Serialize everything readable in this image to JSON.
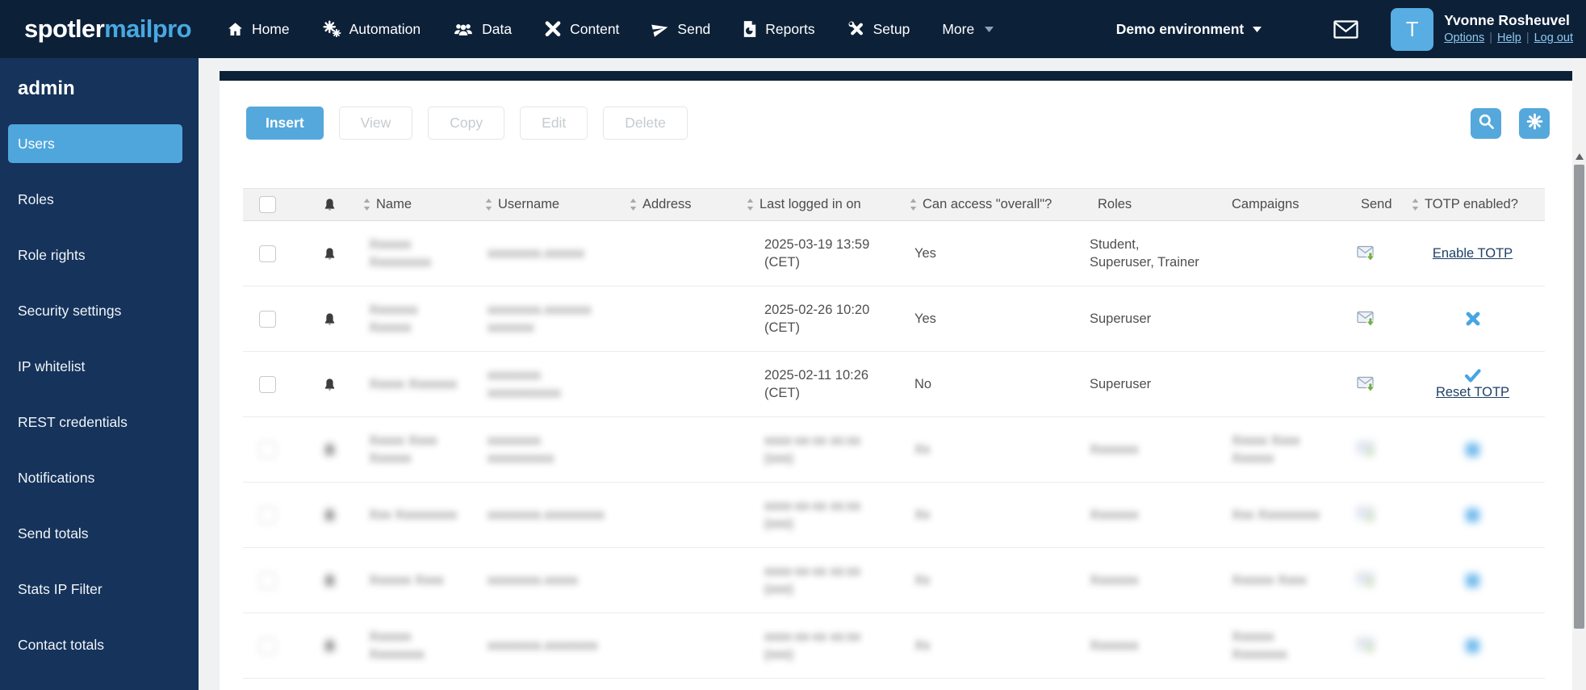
{
  "theme": {
    "topbar_color": "#0c2038",
    "sidebar_color": "#15335b",
    "accent_color": "#55a8db",
    "active_item_color": "#4fa6dc",
    "link_color": "#8ec9ee",
    "totp_icon_color": "#47a5e2"
  },
  "brand": {
    "logo_primary": "spotler",
    "logo_secondary": "mailpro"
  },
  "topnav": {
    "items": [
      {
        "label": "Home",
        "icon": "home-icon"
      },
      {
        "label": "Automation",
        "icon": "gears-icon"
      },
      {
        "label": "Data",
        "icon": "people-icon"
      },
      {
        "label": "Content",
        "icon": "pencil-icon"
      },
      {
        "label": "Send",
        "icon": "paper-plane-icon"
      },
      {
        "label": "Reports",
        "icon": "report-icon"
      },
      {
        "label": "Setup",
        "icon": "tools-icon"
      },
      {
        "label": "More",
        "icon": "caret-down-icon",
        "caret": true
      }
    ]
  },
  "environment": {
    "label": "Demo environment",
    "icon": "caret-down-icon"
  },
  "user": {
    "envelope_icon": "envelope-icon",
    "avatar_initial": "T",
    "name": "Yvonne Rosheuvel",
    "links": [
      "Options",
      "Help",
      "Log out"
    ]
  },
  "sidebar": {
    "heading": "admin",
    "items": [
      {
        "label": "Users",
        "active": true
      },
      {
        "label": "Roles",
        "active": false
      },
      {
        "label": "Role rights",
        "active": false
      },
      {
        "label": "Security settings",
        "active": false
      },
      {
        "label": "IP whitelist",
        "active": false
      },
      {
        "label": "REST credentials",
        "active": false
      },
      {
        "label": "Notifications",
        "active": false
      },
      {
        "label": "Send totals",
        "active": false
      },
      {
        "label": "Stats IP Filter",
        "active": false
      },
      {
        "label": "Contact totals",
        "active": false
      }
    ]
  },
  "toolbar": {
    "buttons": [
      {
        "label": "Insert",
        "primary": true,
        "enabled": true
      },
      {
        "label": "View",
        "primary": false,
        "enabled": false
      },
      {
        "label": "Copy",
        "primary": false,
        "enabled": false
      },
      {
        "label": "Edit",
        "primary": false,
        "enabled": false
      },
      {
        "label": "Delete",
        "primary": false,
        "enabled": false
      }
    ],
    "icon_buttons": [
      {
        "icon": "search-icon"
      },
      {
        "icon": "gear-icon"
      }
    ]
  },
  "table": {
    "columns": [
      {
        "key": "select",
        "label": "",
        "sortable": false
      },
      {
        "key": "notify",
        "label": "",
        "icon": "bell-icon",
        "sortable": false
      },
      {
        "key": "name",
        "label": "Name",
        "sortable": true
      },
      {
        "key": "username",
        "label": "Username",
        "sortable": true
      },
      {
        "key": "address",
        "label": "Address",
        "sortable": true
      },
      {
        "key": "last_login",
        "label": "Last logged in on",
        "sortable": true
      },
      {
        "key": "overall",
        "label": "Can access \"overall\"?",
        "sortable": true
      },
      {
        "key": "roles",
        "label": "Roles",
        "sortable": false
      },
      {
        "key": "campaigns",
        "label": "Campaigns",
        "sortable": false
      },
      {
        "key": "send",
        "label": "Send",
        "sortable": false
      },
      {
        "key": "totp",
        "label": "TOTP enabled?",
        "sortable": true
      }
    ],
    "rows": [
      {
        "blur_all": false,
        "name": {
          "lines": [
            "Xxxxxx",
            "Xxxxxxxxx"
          ],
          "blur": true
        },
        "username": {
          "lines": [
            "xxxxxxxx.xxxxxx"
          ],
          "blur": true
        },
        "address": {
          "lines": []
        },
        "last_login": {
          "lines": [
            "2025-03-19 13:59",
            "(CET)"
          ]
        },
        "overall": {
          "lines": [
            "Yes"
          ]
        },
        "roles": {
          "lines": [
            "Student,",
            "Superuser, Trainer"
          ]
        },
        "campaigns": {
          "lines": []
        },
        "send": {
          "icon": "send-mail-icon"
        },
        "totp": {
          "type": "link",
          "label": "Enable TOTP"
        }
      },
      {
        "blur_all": false,
        "name": {
          "lines": [
            "Xxxxxxx",
            "Xxxxxx"
          ],
          "blur": true
        },
        "username": {
          "lines": [
            "xxxxxxxx.xxxxxxx",
            "xxxxxxx"
          ],
          "blur": true
        },
        "address": {
          "lines": []
        },
        "last_login": {
          "lines": [
            "2025-02-26 10:20",
            "(CET)"
          ]
        },
        "overall": {
          "lines": [
            "Yes"
          ]
        },
        "roles": {
          "lines": [
            "Superuser"
          ]
        },
        "campaigns": {
          "lines": []
        },
        "send": {
          "icon": "send-mail-icon"
        },
        "totp": {
          "type": "cross"
        }
      },
      {
        "blur_all": false,
        "name": {
          "lines": [
            "Xxxxx Xxxxxxx"
          ],
          "blur": true
        },
        "username": {
          "lines": [
            "xxxxxxxx",
            "xxxxxxxxxxx"
          ],
          "blur": true
        },
        "address": {
          "lines": []
        },
        "last_login": {
          "lines": [
            "2025-02-11 10:26",
            "(CET)"
          ]
        },
        "overall": {
          "lines": [
            "No"
          ]
        },
        "roles": {
          "lines": [
            "Superuser"
          ]
        },
        "campaigns": {
          "lines": []
        },
        "send": {
          "icon": "send-mail-icon"
        },
        "totp": {
          "type": "check-link",
          "label": "Reset TOTP"
        }
      },
      {
        "blur_all": true,
        "name": {
          "lines": [
            "Xxxxx Xxxx",
            "Xxxxxx"
          ],
          "blur": true
        },
        "username": {
          "lines": [
            "xxxxxxxx",
            "xxxxxxxxxx"
          ],
          "blur": true
        },
        "address": {
          "lines": []
        },
        "last_login": {
          "lines": [
            "xxxx-xx-xx xx:xx",
            "(xxx)"
          ],
          "blur": true
        },
        "overall": {
          "lines": [
            "Xx"
          ],
          "blur": true
        },
        "roles": {
          "lines": [
            "Xxxxxxx"
          ],
          "blur": true
        },
        "campaigns": {
          "lines": [
            "Xxxxx Xxxx",
            "Xxxxxx"
          ],
          "blur": true
        },
        "send": {
          "icon": "send-mail-icon"
        },
        "totp": {
          "type": "square"
        }
      },
      {
        "blur_all": true,
        "name": {
          "lines": [
            "Xxx Xxxxxxxxx"
          ],
          "blur": true
        },
        "username": {
          "lines": [
            "xxxxxxxx.xxxxxxxxx"
          ],
          "blur": true
        },
        "address": {
          "lines": []
        },
        "last_login": {
          "lines": [
            "xxxx-xx-xx xx:xx",
            "(xxx)"
          ],
          "blur": true
        },
        "overall": {
          "lines": [
            "Xx"
          ],
          "blur": true
        },
        "roles": {
          "lines": [
            "Xxxxxxx"
          ],
          "blur": true
        },
        "campaigns": {
          "lines": [
            "Xxx Xxxxxxxxx"
          ],
          "blur": true
        },
        "send": {
          "icon": "send-mail-icon"
        },
        "totp": {
          "type": "square"
        }
      },
      {
        "blur_all": true,
        "name": {
          "lines": [
            "Xxxxxx Xxxx"
          ],
          "blur": true
        },
        "username": {
          "lines": [
            "xxxxxxxx.xxxxx"
          ],
          "blur": true
        },
        "address": {
          "lines": []
        },
        "last_login": {
          "lines": [
            "xxxx-xx-xx xx:xx",
            "(xxx)"
          ],
          "blur": true
        },
        "overall": {
          "lines": [
            "Xx"
          ],
          "blur": true
        },
        "roles": {
          "lines": [
            "Xxxxxxx"
          ],
          "blur": true
        },
        "campaigns": {
          "lines": [
            "Xxxxxx Xxxx"
          ],
          "blur": true
        },
        "send": {
          "icon": "send-mail-icon"
        },
        "totp": {
          "type": "square"
        }
      },
      {
        "blur_all": true,
        "name": {
          "lines": [
            "Xxxxxx",
            "Xxxxxxxx"
          ],
          "blur": true
        },
        "username": {
          "lines": [
            "xxxxxxxx.xxxxxxxx"
          ],
          "blur": true
        },
        "address": {
          "lines": []
        },
        "last_login": {
          "lines": [
            "xxxx-xx-xx xx:xx",
            "(xxx)"
          ],
          "blur": true
        },
        "overall": {
          "lines": [
            "Xx"
          ],
          "blur": true
        },
        "roles": {
          "lines": [
            "Xxxxxxx"
          ],
          "blur": true
        },
        "campaigns": {
          "lines": [
            "Xxxxxx",
            "Xxxxxxxx"
          ],
          "blur": true
        },
        "send": {
          "icon": "send-mail-icon"
        },
        "totp": {
          "type": "square"
        }
      }
    ]
  }
}
